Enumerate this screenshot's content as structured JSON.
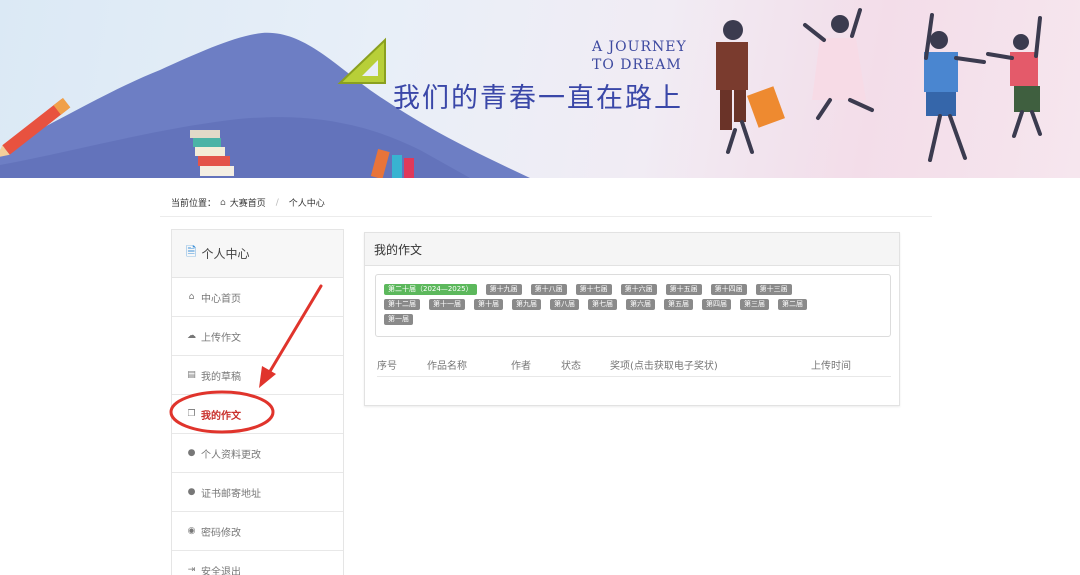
{
  "banner": {
    "slogan_en_line1": "A JOURNEY",
    "slogan_en_line2": "TO DREAM",
    "slogan_cn": "我们的青春一直在路上"
  },
  "breadcrumb": {
    "label": "当前位置：",
    "home_icon": "home-icon",
    "home": "大赛首页",
    "current": "个人中心"
  },
  "sidebar": {
    "title": "个人中心",
    "title_icon": "document-icon",
    "items": [
      {
        "label": "中心首页",
        "icon": "home-icon"
      },
      {
        "label": "上传作文",
        "icon": "cloud-upload-icon"
      },
      {
        "label": "我的草稿",
        "icon": "draft-icon"
      },
      {
        "label": "我的作文",
        "icon": "copy-icon",
        "active": true
      },
      {
        "label": "个人资料更改",
        "icon": "user-icon"
      },
      {
        "label": "证书邮寄地址",
        "icon": "user-icon"
      },
      {
        "label": "密码修改",
        "icon": "comment-icon"
      },
      {
        "label": "安全退出",
        "icon": "logout-icon"
      }
    ]
  },
  "panel": {
    "title": "我的作文",
    "tabs": [
      "第二十届（2024—2025）",
      "第十九届",
      "第十八届",
      "第十七届",
      "第十六届",
      "第十五届",
      "第十四届",
      "第十三届",
      "第十二届",
      "第十一届",
      "第十届",
      "第九届",
      "第八届",
      "第七届",
      "第六届",
      "第五届",
      "第四届",
      "第三届",
      "第二届",
      "第一届"
    ],
    "active_tab": "第二十届（2024—2025）",
    "columns": [
      "序号",
      "作品名称",
      "作者",
      "状态",
      "奖项(点击获取电子奖状)",
      "上传时间"
    ]
  },
  "colors": {
    "active_tab": "#5cb85c",
    "inactive_tab": "#8a8a8a",
    "active_menu": "#c9302c",
    "annotation": "#e0342c",
    "slogan": "#3a47a8"
  }
}
